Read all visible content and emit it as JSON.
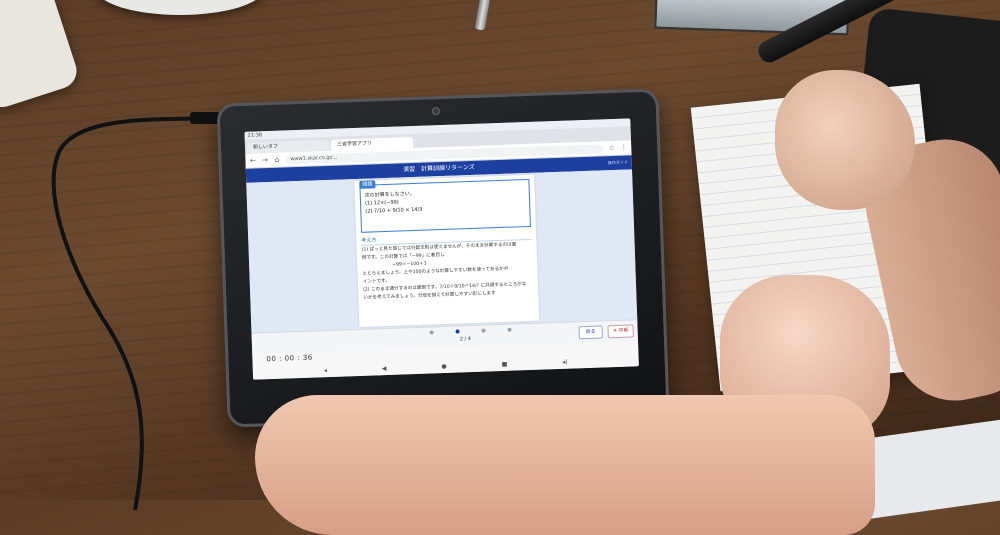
{
  "browser": {
    "status_time": "21:38",
    "tabs": [
      {
        "label": "新しいタブ"
      },
      {
        "label": "三省学習アプリ"
      }
    ],
    "url": "www1.skar.co.jp/..."
  },
  "app": {
    "header_title": "演習　計算訓練リターンズ",
    "header_right": "操作ガイド"
  },
  "problem": {
    "tag": "問題",
    "prompt": "次の計算をしなさい。",
    "item1": "(1)  12×(−99)",
    "item2": "(2)  7/10 + 9/10 × 14/3"
  },
  "explanation": {
    "title": "考え方",
    "lines": [
      "(1)  ぱっと見た感じでは分配法則は使えませんが、そのまま計算するのは面",
      "倒です。この計算では「−99」に着目し",
      "−99＝−100＋1",
      "ととらえましょう。上や100のような計算しやすい数を使ってあるかポ",
      "イントです。",
      "(2)  このまま通分するのは面倒です。7/10＋9/10＝14/? に共通するところがな",
      "いかを考えてみましょう。分母を揃えて計算しやすい形にします"
    ]
  },
  "footer": {
    "page": "2 / 4",
    "back_label": "戻る",
    "quit_label": "✕ 中断",
    "timer": "00 : 00 : 36"
  }
}
